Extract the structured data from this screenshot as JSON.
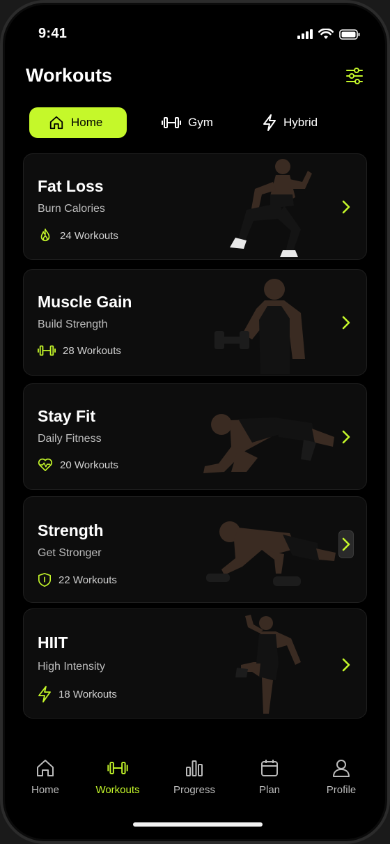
{
  "status": {
    "time": "9:41"
  },
  "header": {
    "title": "Workouts"
  },
  "tabs": [
    {
      "label": "Home",
      "icon": "home-icon",
      "active": true
    },
    {
      "label": "Gym",
      "icon": "dumbbell-icon",
      "active": false
    },
    {
      "label": "Hybrid",
      "icon": "lightning-icon",
      "active": false
    }
  ],
  "cards": [
    {
      "title": "Fat Loss",
      "subtitle": "Burn Calories",
      "count": "24 Workouts",
      "icon": "flame-icon",
      "photo": "runner-photo"
    },
    {
      "title": "Muscle Gain",
      "subtitle": "Build Strength",
      "count": "28 Workouts",
      "icon": "dumbbell-icon",
      "photo": "dumbbell-curl-photo"
    },
    {
      "title": "Stay Fit",
      "subtitle": "Daily Fitness",
      "count": "20 Workouts",
      "icon": "heartbeat-icon",
      "photo": "plank-photo"
    },
    {
      "title": "Strength",
      "subtitle": "Get Stronger",
      "count": "22 Workouts",
      "icon": "shield-icon",
      "photo": "pushup-photo"
    },
    {
      "title": "HIIT",
      "subtitle": "High Intensity",
      "count": "18 Workouts",
      "icon": "lightning-icon",
      "photo": "high-knee-photo"
    }
  ],
  "nav": [
    {
      "label": "Home",
      "icon": "home-icon",
      "active": false
    },
    {
      "label": "Workouts",
      "icon": "dumbbell-icon",
      "active": true
    },
    {
      "label": "Progress",
      "icon": "bar-chart-icon",
      "active": false
    },
    {
      "label": "Plan",
      "icon": "calendar-icon",
      "active": false
    },
    {
      "label": "Profile",
      "icon": "user-icon",
      "active": false
    }
  ],
  "colors": {
    "accent": "#c5f82a",
    "background": "#000000",
    "card": "#0d0d0d"
  }
}
